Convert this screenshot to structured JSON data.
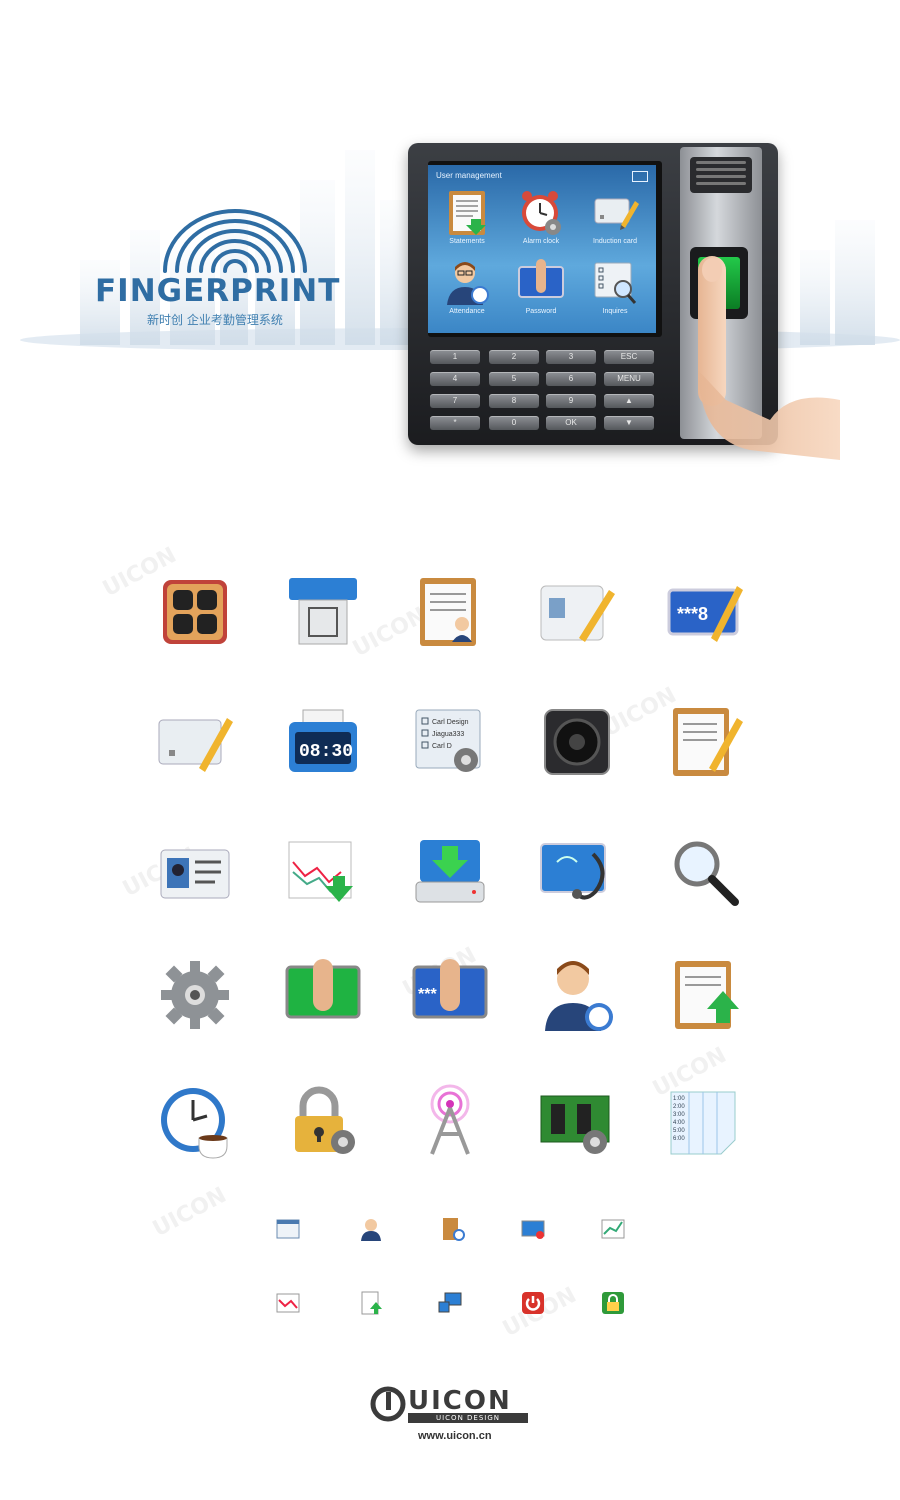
{
  "hero": {
    "brand": "FINGERPRINT",
    "tagline": "新时创 企业考勤管理系统"
  },
  "device": {
    "screen_title": "User management",
    "tiles": [
      {
        "label": "Statements"
      },
      {
        "label": "Alarm clock"
      },
      {
        "label": "Induction card"
      },
      {
        "label": "Attendance"
      },
      {
        "label": "Password"
      },
      {
        "label": "Inquires"
      }
    ],
    "password_text": "*** 8",
    "inquire_lines": [
      "Carl Design",
      "Jiagua333"
    ],
    "keys": [
      "1",
      "2",
      "3",
      "ESC",
      "4",
      "5",
      "6",
      "MENU",
      "7",
      "8",
      "9",
      "▲",
      "*",
      "0",
      "OK",
      "▼"
    ]
  },
  "icons": {
    "row1": [
      "keypad-icon",
      "usb-drive-icon",
      "clipboard-user-icon",
      "id-card-edit-icon",
      "password-edit-icon"
    ],
    "row2": [
      "card-edit-icon",
      "clock-display-icon",
      "checklist-settings-icon",
      "speaker-icon",
      "clipboard-edit-icon"
    ],
    "row3": [
      "id-badge-icon",
      "chart-download-icon",
      "drive-download-icon",
      "diagnostics-icon",
      "search-icon"
    ],
    "row4": [
      "gear-icon",
      "fingerprint-scan-icon",
      "password-finger-icon",
      "user-clock-icon",
      "clipboard-upload-icon"
    ],
    "row5": [
      "clock-coffee-icon",
      "lock-settings-icon",
      "antenna-icon",
      "circuit-settings-icon",
      "schedule-sheet-icon"
    ],
    "small_row1": [
      "window-icon",
      "user-small-icon",
      "door-clock-icon",
      "screen-add-icon",
      "chart-small-icon"
    ],
    "small_row2": [
      "line-chart-small-icon",
      "document-upload-icon",
      "network-computer-icon",
      "power-icon",
      "lock-small-icon"
    ],
    "clock_display": "08:30",
    "checklist_lines": [
      "Carl Design",
      "Jiagua333",
      "Carl D"
    ],
    "schedule_times": [
      "1:00",
      "2:00",
      "3:00",
      "4:00",
      "5:00",
      "6:00"
    ]
  },
  "footer": {
    "brand": "UICON",
    "sub": "UICON DESIGN",
    "url": "www.uicon.cn"
  },
  "colors": {
    "brand_blue": "#2f6da3",
    "screen_blue": "#3b86c6",
    "sensor_green": "#1fb342"
  }
}
